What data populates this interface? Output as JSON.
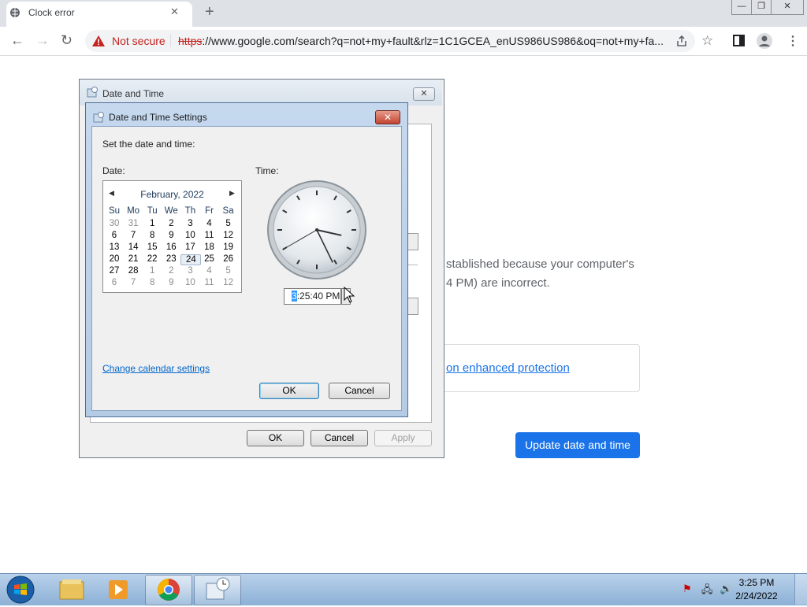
{
  "browser": {
    "tab_title": "Clock error",
    "tab_close": "✕",
    "new_tab": "+",
    "window_controls": {
      "minimize": "—",
      "restore": "❐",
      "close": "✕"
    },
    "security_label": "Not secure",
    "url_scheme": "https",
    "url_rest": "://www.google.com/search?q=not+my+fault&rlz=1C1GCEA_enUS986US986&oq=not+my+fa..."
  },
  "page": {
    "error_line1": "stablished because your computer's",
    "error_line2": "4 PM) are incorrect.",
    "enhanced_link": "on enhanced protection",
    "update_button": "Update date and time"
  },
  "outer_dialog": {
    "title": "Date and Time",
    "close": "✕",
    "ok": "OK",
    "cancel": "Cancel",
    "apply": "Apply"
  },
  "inner_dialog": {
    "title": "Date and Time Settings",
    "close": "✕",
    "set_label": "Set the date and time:",
    "date_label": "Date:",
    "time_label": "Time:",
    "calendar": {
      "month": "February, 2022",
      "days_of_week": [
        "Su",
        "Mo",
        "Tu",
        "We",
        "Th",
        "Fr",
        "Sa"
      ],
      "weeks": [
        [
          "30",
          "31",
          "1",
          "2",
          "3",
          "4",
          "5"
        ],
        [
          "6",
          "7",
          "8",
          "9",
          "10",
          "11",
          "12"
        ],
        [
          "13",
          "14",
          "15",
          "16",
          "17",
          "18",
          "19"
        ],
        [
          "20",
          "21",
          "22",
          "23",
          "24",
          "25",
          "26"
        ],
        [
          "27",
          "28",
          "1",
          "2",
          "3",
          "4",
          "5"
        ],
        [
          "6",
          "7",
          "8",
          "9",
          "10",
          "11",
          "12"
        ]
      ],
      "selected_day": "24"
    },
    "time_selected_part": "3",
    "time_rest": ":25:40 PM",
    "change_calendar_link": "Change calendar settings",
    "ok": "OK",
    "cancel": "Cancel"
  },
  "taskbar": {
    "time": "3:25 PM",
    "date": "2/24/2022"
  }
}
